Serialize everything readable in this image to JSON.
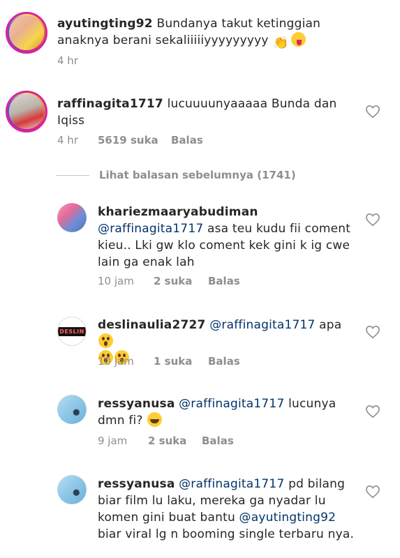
{
  "comments": [
    {
      "username": "ayutingting92",
      "text": "Bundanya takut ketinggian anaknya berani sekaliiiiiyyyyyyyyy",
      "time": "4 hr"
    },
    {
      "username": "raffinagita1717",
      "text": "lucuuuunyaaaaa Bunda dan Iqiss",
      "time": "4 hr",
      "likes": "5619 suka",
      "reply": "Balas"
    }
  ],
  "view_previous": "Lihat balasan sebelumnya (1741)",
  "replies": [
    {
      "username": "khariezmaaryabudiman",
      "mention": "@raffinagita1717",
      "text": "asa teu kudu fii coment kieu.. Lki gw klo coment kek gini k ig cwe lain ga enak lah",
      "time": "10 jam",
      "likes": "2 suka",
      "reply": "Balas"
    },
    {
      "username": "deslinaulia2727",
      "mention": "@raffinagita1717",
      "text": "apa",
      "time": "10 jam",
      "likes": "1 suka",
      "reply": "Balas",
      "avatar_text": "DESLIN"
    },
    {
      "username": "ressyanusa",
      "mention": "@raffinagita1717",
      "text": "lucunya dmn fi?",
      "time": "9 jam",
      "likes": "2 suka",
      "reply": "Balas"
    },
    {
      "username": "ressyanusa",
      "mention": "@raffinagita1717",
      "text": "pd bilang biar film lu laku, mereka ga nyadar lu komen gini buat bantu",
      "mention2": "@ayutingting92",
      "text2": "biar viral lg n booming single terbaru nya."
    }
  ],
  "colors": {
    "mention": "#003569",
    "meta": "#8e8e8e",
    "ring": "#d6249f"
  },
  "icons": {
    "like": "heart-outline-icon"
  }
}
